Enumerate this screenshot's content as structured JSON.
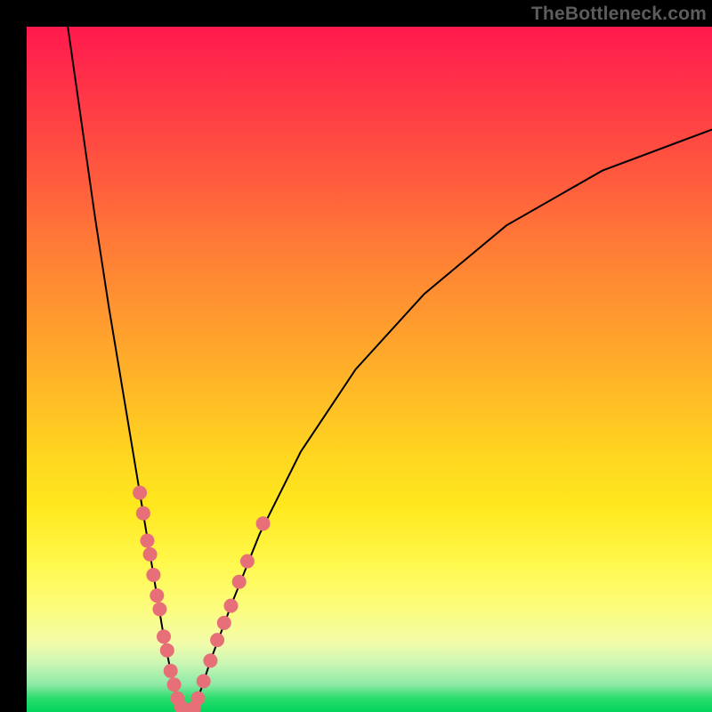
{
  "watermark": "TheBottleneck.com",
  "colors": {
    "frame": "#000000",
    "curve": "#000000",
    "dots": "#e76f78",
    "gradient_top": "#ff1a4d",
    "gradient_bottom": "#00d45c"
  },
  "chart_data": {
    "type": "line",
    "title": "",
    "xlabel": "",
    "ylabel": "",
    "xlim": [
      0,
      100
    ],
    "ylim": [
      0,
      100
    ],
    "annotations": [
      "TheBottleneck.com"
    ],
    "series": [
      {
        "name": "bottleneck-curve",
        "x": [
          6,
          8,
          10,
          12,
          14,
          16,
          18,
          19,
          20,
          21,
          22,
          23,
          24,
          25,
          27,
          30,
          34,
          40,
          48,
          58,
          70,
          84,
          100
        ],
        "values": [
          100,
          86,
          72,
          59,
          47,
          35,
          23,
          17,
          11,
          6,
          2,
          0,
          0,
          2,
          8,
          16,
          26,
          38,
          50,
          61,
          71,
          79,
          85
        ]
      }
    ],
    "points": [
      {
        "name": "cluster-left",
        "x": 16.5,
        "y": 32
      },
      {
        "name": "cluster-left",
        "x": 17.0,
        "y": 29
      },
      {
        "name": "cluster-left",
        "x": 17.6,
        "y": 25
      },
      {
        "name": "cluster-left",
        "x": 18.0,
        "y": 23
      },
      {
        "name": "cluster-left",
        "x": 18.5,
        "y": 20
      },
      {
        "name": "cluster-left",
        "x": 19.0,
        "y": 17
      },
      {
        "name": "cluster-left",
        "x": 19.4,
        "y": 15
      },
      {
        "name": "cluster-left",
        "x": 20.0,
        "y": 11
      },
      {
        "name": "cluster-left",
        "x": 20.5,
        "y": 9
      },
      {
        "name": "cluster-left",
        "x": 21.0,
        "y": 6
      },
      {
        "name": "cluster-left",
        "x": 21.5,
        "y": 4
      },
      {
        "name": "cluster-bottom",
        "x": 22.0,
        "y": 2
      },
      {
        "name": "cluster-bottom",
        "x": 22.6,
        "y": 0.7
      },
      {
        "name": "cluster-bottom",
        "x": 23.2,
        "y": 0
      },
      {
        "name": "cluster-bottom",
        "x": 23.8,
        "y": 0
      },
      {
        "name": "cluster-bottom",
        "x": 24.4,
        "y": 0.6
      },
      {
        "name": "cluster-bottom",
        "x": 25.0,
        "y": 2
      },
      {
        "name": "cluster-right",
        "x": 25.8,
        "y": 4.5
      },
      {
        "name": "cluster-right",
        "x": 26.8,
        "y": 7.5
      },
      {
        "name": "cluster-right",
        "x": 27.8,
        "y": 10.5
      },
      {
        "name": "cluster-right",
        "x": 28.8,
        "y": 13
      },
      {
        "name": "cluster-right",
        "x": 29.8,
        "y": 15.5
      },
      {
        "name": "cluster-right",
        "x": 31.0,
        "y": 19
      },
      {
        "name": "cluster-right",
        "x": 32.2,
        "y": 22
      },
      {
        "name": "cluster-right-outlier",
        "x": 34.5,
        "y": 27.5
      }
    ]
  }
}
